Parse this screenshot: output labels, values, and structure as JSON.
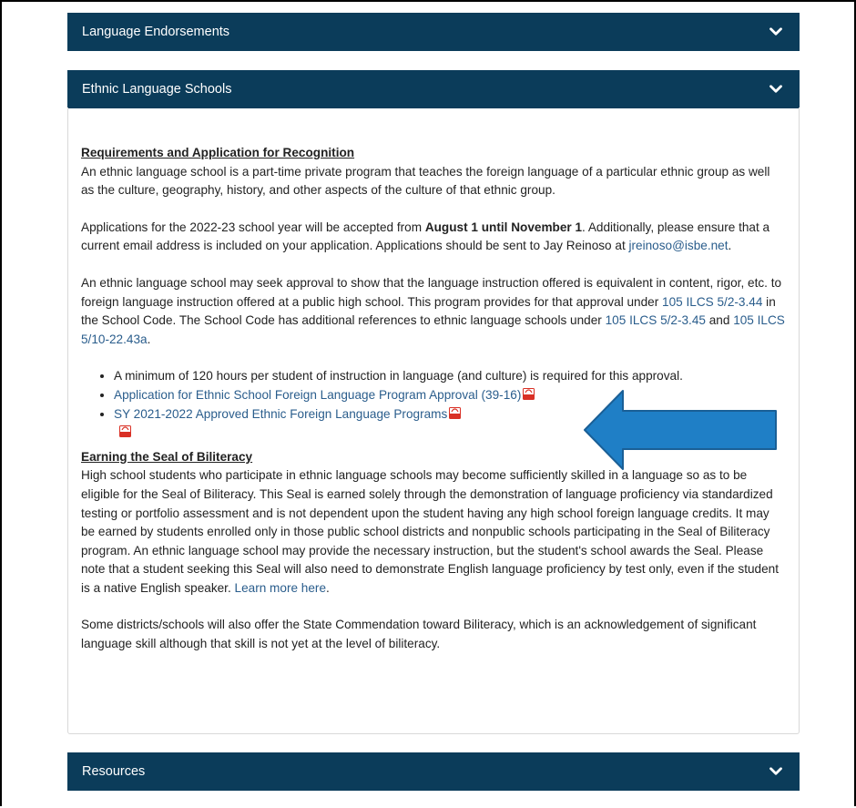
{
  "accordions": {
    "language_endorsements": "Language Endorsements",
    "ethnic_language_schools": "Ethnic Language Schools",
    "resources": "Resources"
  },
  "section1": {
    "heading": "Requirements and Application for Recognition",
    "p1": "An ethnic language school is a part-time private program that teaches the foreign language of a particular ethnic group as well as the culture, geography, history, and other aspects of the culture of that ethnic group.",
    "p2_a": "Applications for the 2022-23 school year will be accepted from ",
    "p2_bold": "August 1 until November 1",
    "p2_b": ". Additionally, please ensure that a current email address is included on your application. Applications should be sent to Jay Reinoso at ",
    "p2_email": "jreinoso@isbe.net",
    "p2_c": ".",
    "p3_a": "An ethnic language school may seek approval to show that the language instruction offered is equivalent in content, rigor, etc. to foreign language instruction offered at a public high school. This program provides for that approval under ",
    "p3_link1": "105 ILCS 5/2-3.44",
    "p3_b": " in the School Code. The School Code has additional references to ethnic language schools under ",
    "p3_link2": "105 ILCS 5/2-3.45",
    "p3_c": " and ",
    "p3_link3": "105 ILCS 5/10-22.43a",
    "p3_d": "."
  },
  "bullets": {
    "item1": "A minimum of 120 hours per student of instruction in language (and culture) is required for this approval.",
    "item2": "Application for Ethnic School Foreign Language Program Approval (39-16)",
    "item3": "SY 2021-2022 Approved Ethnic Foreign Language Programs"
  },
  "section2": {
    "heading": "Earning the Seal of Biliteracy",
    "p1_a": "High school students who participate in ethnic language schools may become sufficiently skilled in a language so as to be eligible for the Seal of Biliteracy. This Seal is earned solely through the demonstration of language proficiency via standardized testing or portfolio assessment and is not dependent upon the student having any high school foreign language credits. It may be earned by students enrolled only in those public school districts and nonpublic schools participating in the Seal of Biliteracy program. An ethnic language school may provide the necessary instruction, but the student's school awards the Seal. Please note that a student seeking this Seal will also need to demonstrate English language proficiency by test only, even if the student is a native English speaker. ",
    "p1_link": "Learn more here",
    "p1_b": ".",
    "p2": "Some districts/schools will also offer the State Commendation toward Biliteracy, which is an acknowledgement of significant language skill although that skill is not yet at the level of biliteracy."
  },
  "colors": {
    "accordion_bg": "#0b3c5a",
    "link": "#2a5d8c",
    "arrow_fill": "#1f7fc6",
    "pdf_red": "#d93025"
  },
  "icons": {
    "chevron": "chevron-down-icon",
    "pdf": "pdf-icon",
    "arrow": "arrow-left-icon"
  }
}
